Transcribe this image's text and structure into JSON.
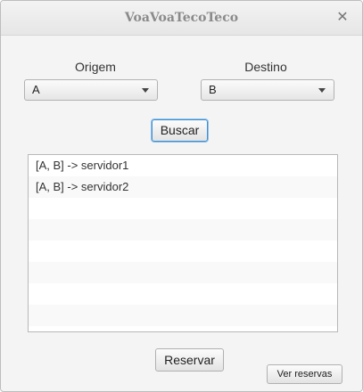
{
  "window": {
    "title": "VoaVoaTecoTeco",
    "close_glyph": "✕"
  },
  "origin": {
    "label": "Origem",
    "selected": "A"
  },
  "destination": {
    "label": "Destino",
    "selected": "B"
  },
  "buttons": {
    "search": "Buscar",
    "reserve": "Reservar",
    "view_reservations": "Ver reservas"
  },
  "results": {
    "items": [
      "[A, B] -> servidor1",
      "[A, B] -> servidor2"
    ]
  }
}
